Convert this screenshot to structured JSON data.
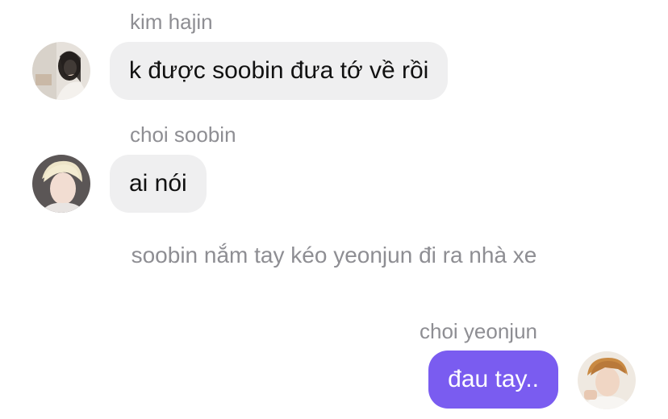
{
  "messages": [
    {
      "sender": "kim hajin",
      "text": "k được soobin đưa tớ về rồi",
      "avatar_icon": "hajin-avatar"
    },
    {
      "sender": "choi soobin",
      "text": "ai nói",
      "avatar_icon": "soobin-avatar"
    }
  ],
  "narration": "soobin nắm tay kéo yeonjun đi ra nhà xe",
  "outgoing": {
    "sender": "choi yeonjun",
    "text": "đau tay..",
    "avatar_icon": "yeonjun-avatar"
  },
  "colors": {
    "incoming_bubble": "#efeff0",
    "outgoing_bubble": "#7a5cf0",
    "sender_text": "#8e8e93"
  }
}
